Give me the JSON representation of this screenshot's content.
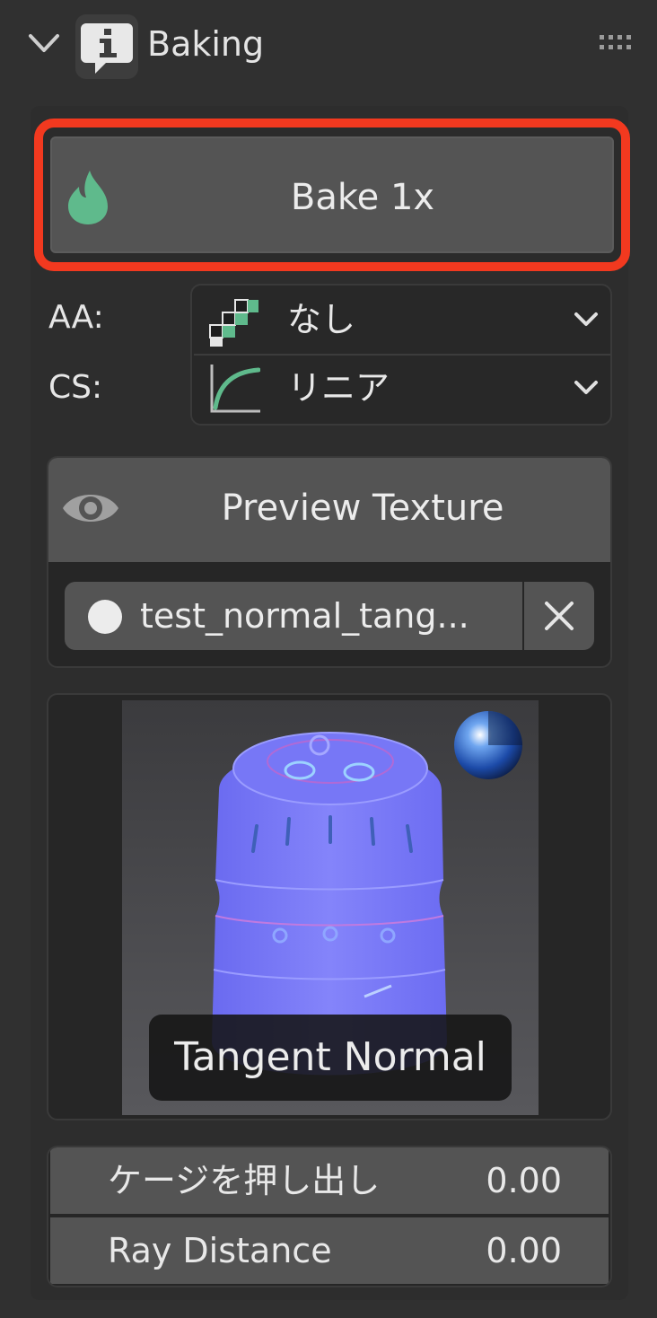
{
  "header": {
    "title": "Baking",
    "collapse_icon": "chevron-down-icon",
    "panel_icon": "info-speech-icon",
    "grip_icon": "drag-grip-icon"
  },
  "bake": {
    "label": "Bake 1x",
    "icon": "flame-icon",
    "highlight_color": "#f2391f"
  },
  "settings": {
    "aa": {
      "label": "AA:",
      "value": "なし",
      "icon": "checker-icon"
    },
    "cs": {
      "label": "CS:",
      "value": "リニア",
      "icon": "curve-icon"
    }
  },
  "preview": {
    "button_label": "Preview Texture",
    "button_icon": "eye-icon",
    "image_name": "test_normal_tang...",
    "clear_icon": "close-icon"
  },
  "render": {
    "mode_label": "Tangent Normal",
    "shading_icon": "material-sphere-icon"
  },
  "fields": [
    {
      "label": "ケージを押し出し",
      "value": "0.00"
    },
    {
      "label": "Ray Distance",
      "value": "0.00"
    }
  ],
  "colors": {
    "accent_green": "#5fba8c",
    "normal_map_blue": "#7d7df5"
  }
}
